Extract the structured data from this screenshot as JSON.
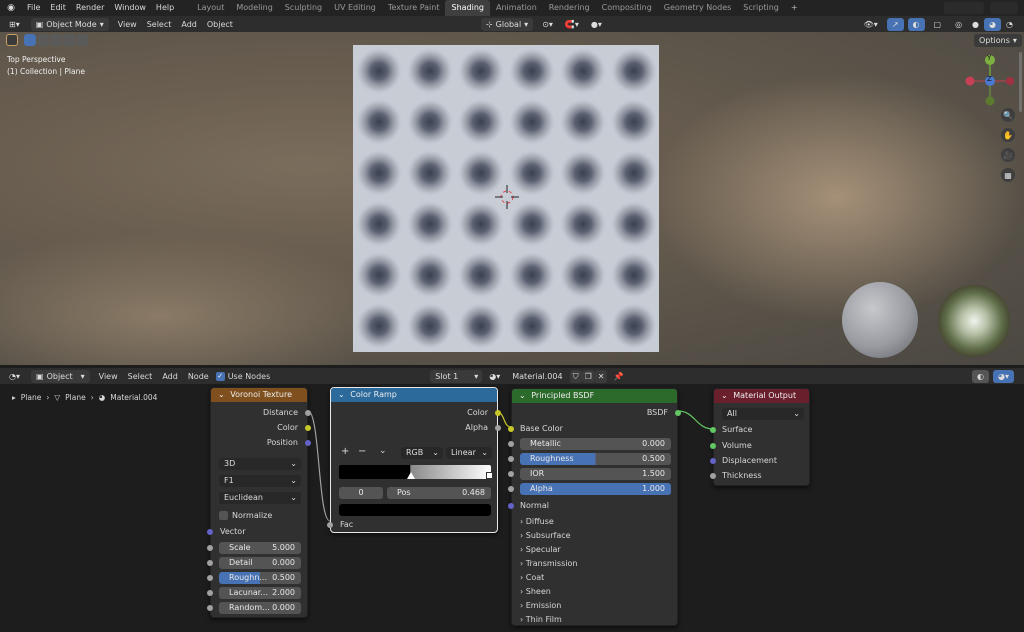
{
  "topbar": {
    "menus": [
      "File",
      "Edit",
      "Render",
      "Window",
      "Help"
    ],
    "workspaces": [
      "Layout",
      "Modeling",
      "Sculpting",
      "UV Editing",
      "Texture Paint",
      "Shading",
      "Animation",
      "Rendering",
      "Compositing",
      "Geometry Nodes",
      "Scripting"
    ],
    "active_workspace": "Shading",
    "add_tab": "+"
  },
  "viewport_header": {
    "mode": "Object Mode",
    "menus": [
      "View",
      "Select",
      "Add",
      "Object"
    ],
    "transform_orientation": "Global",
    "options": "Options"
  },
  "viewport": {
    "view_name": "Top Perspective",
    "collection_info": "(1) Collection | Plane",
    "gizmo": {
      "y": "Y",
      "z": "Z"
    }
  },
  "node_header": {
    "editor_type": "Object",
    "menus": [
      "View",
      "Select",
      "Add",
      "Node"
    ],
    "use_nodes_label": "Use Nodes",
    "use_nodes_checked": true,
    "slot": "Slot 1",
    "material": "Material.004"
  },
  "breadcrumb": [
    "Plane",
    "Plane",
    "Material.004"
  ],
  "voronoi": {
    "title": "Voronoi Texture",
    "outputs": [
      "Distance",
      "Color",
      "Position"
    ],
    "dims": "3D",
    "feature": "F1",
    "metric": "Euclidean",
    "normalize_label": "Normalize",
    "vector_label": "Vector",
    "fields": [
      {
        "label": "Scale",
        "value": "5.000"
      },
      {
        "label": "Detail",
        "value": "0.000"
      },
      {
        "label": "Roughn...",
        "value": "0.500",
        "fill": 0.5
      },
      {
        "label": "Lacunar...",
        "value": "2.000"
      },
      {
        "label": "Random...",
        "value": "0.000"
      }
    ]
  },
  "color_ramp": {
    "title": "Color Ramp",
    "outputs": [
      "Color",
      "Alpha"
    ],
    "add": "+",
    "remove": "−",
    "mode": "RGB",
    "interpolation": "Linear",
    "stop_index": "0",
    "pos_label": "Pos",
    "pos_value": "0.468",
    "fac_label": "Fac"
  },
  "principled": {
    "title": "Principled BSDF",
    "output": "BSDF",
    "base_color": "Base Color",
    "fields": [
      {
        "label": "Metallic",
        "value": "0.000",
        "fill": 0
      },
      {
        "label": "Roughness",
        "value": "0.500",
        "fill": 0.5
      },
      {
        "label": "IOR",
        "value": "1.500",
        "fill": 0
      },
      {
        "label": "Alpha",
        "value": "1.000",
        "fill": 1
      }
    ],
    "normal": "Normal",
    "panels": [
      "Diffuse",
      "Subsurface",
      "Specular",
      "Transmission",
      "Coat",
      "Sheen",
      "Emission",
      "Thin Film"
    ]
  },
  "material_output": {
    "title": "Material Output",
    "target": "All",
    "inputs": [
      "Surface",
      "Volume",
      "Displacement",
      "Thickness"
    ]
  },
  "colors": {
    "accent_blue": "#4772b3",
    "voronoi_header": "#7f4f1e",
    "ramp_header": "#2b6a9a",
    "bsdf_header": "#2c6a2c",
    "output_header": "#6a1f2c"
  }
}
